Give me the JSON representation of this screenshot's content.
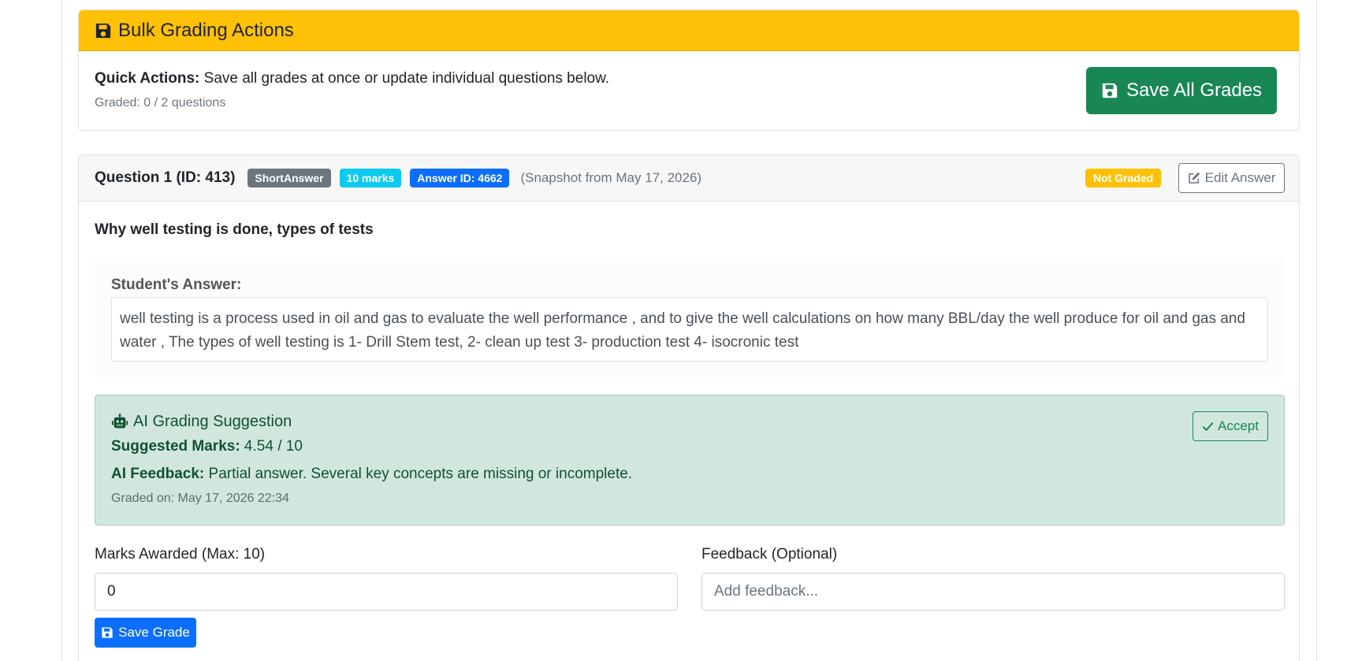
{
  "bulk": {
    "title": "Bulk Grading Actions",
    "quick_label": "Quick Actions:",
    "quick_text": " Save all grades at once or update individual questions below.",
    "graded_count": "Graded: 0 / 2 questions",
    "save_all_label": "Save All Grades"
  },
  "question": {
    "title": "Question 1 (ID: 413)",
    "type_badge": "ShortAnswer",
    "marks_badge": "10 marks",
    "answer_id_badge": "Answer ID: 4662",
    "snapshot": "(Snapshot from May 17, 2026)",
    "status_badge": "Not Graded",
    "edit_label": "Edit Answer",
    "prompt": "Why well testing is done, types of tests",
    "student_answer_label": "Student's Answer:",
    "student_answer": "well testing is a process used in oil and gas to evaluate the well performance , and to give the well calculations on how many BBL/day the well produce for oil and gas and water , The types of well testing is 1- Drill Stem test, 2- clean up test 3- production test 4- isocronic test"
  },
  "ai": {
    "title": "AI Grading Suggestion",
    "marks_label": "Suggested Marks:",
    "marks_value": " 4.54 / 10",
    "feedback_label": "AI Feedback:",
    "feedback_value": " Partial answer. Several key concepts are missing or incomplete.",
    "graded_on": "Graded on: May 17, 2026 22:34",
    "accept_label": "Accept"
  },
  "form": {
    "marks_label": "Marks Awarded (Max: 10)",
    "marks_value": "0",
    "feedback_label": "Feedback (Optional)",
    "feedback_placeholder": "Add feedback...",
    "save_label": "Save Grade"
  },
  "colors": {
    "warning": "#ffc107",
    "success": "#198754",
    "primary": "#0d6efd",
    "info": "#0dcaf0",
    "secondary": "#6c757d",
    "ai_bg": "#d1e7dd"
  },
  "icons": [
    "save-icon",
    "edit-icon",
    "robot-icon",
    "check-icon"
  ]
}
